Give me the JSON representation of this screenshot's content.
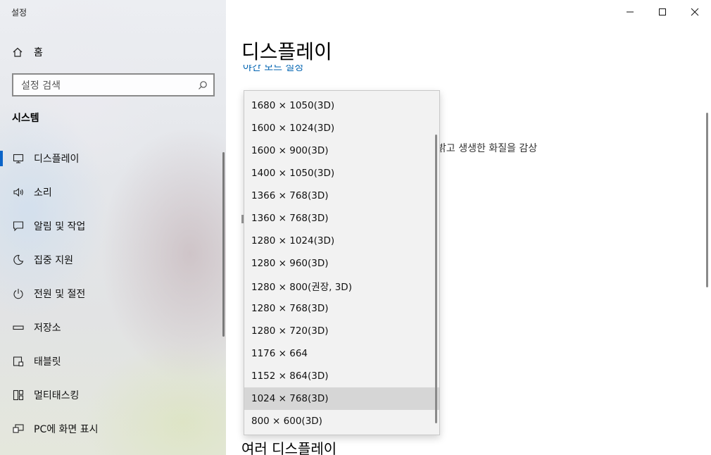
{
  "window": {
    "title": "설정"
  },
  "sidebar": {
    "home_label": "홈",
    "search_placeholder": "설정 검색",
    "section_title": "시스템",
    "items": [
      {
        "label": "디스플레이",
        "icon": "monitor-icon",
        "active": true
      },
      {
        "label": "소리",
        "icon": "speaker-icon"
      },
      {
        "label": "알림 및 작업",
        "icon": "notification-icon"
      },
      {
        "label": "집중 지원",
        "icon": "moon-icon"
      },
      {
        "label": "전원 및 절전",
        "icon": "power-icon"
      },
      {
        "label": "저장소",
        "icon": "storage-icon"
      },
      {
        "label": "태블릿",
        "icon": "tablet-icon"
      },
      {
        "label": "멀티태스킹",
        "icon": "multitasking-icon"
      },
      {
        "label": "PC에 화면 표시",
        "icon": "project-icon"
      }
    ]
  },
  "main": {
    "page_title": "디스플레이",
    "night_light_link": "야간 모드 설정",
    "partial_text": "밝고 생생한 화질을 감상",
    "multi_display_title": "여러 디스플레이"
  },
  "resolution_dropdown": {
    "options": [
      "1680 × 1050(3D)",
      "1600 × 1024(3D)",
      "1600 × 900(3D)",
      "1400 × 1050(3D)",
      "1366 × 768(3D)",
      "1360 × 768(3D)",
      "1280 × 1024(3D)",
      "1280 × 960(3D)",
      "1280 × 800(권장, 3D)",
      "1280 × 768(3D)",
      "1280 × 720(3D)",
      "1176 × 664",
      "1152 × 864(3D)",
      "1024 × 768(3D)",
      "800 × 600(3D)"
    ],
    "selected": "1024 × 768(3D)"
  },
  "colors": {
    "accent": "#0a64c8",
    "link": "#0063b1"
  }
}
